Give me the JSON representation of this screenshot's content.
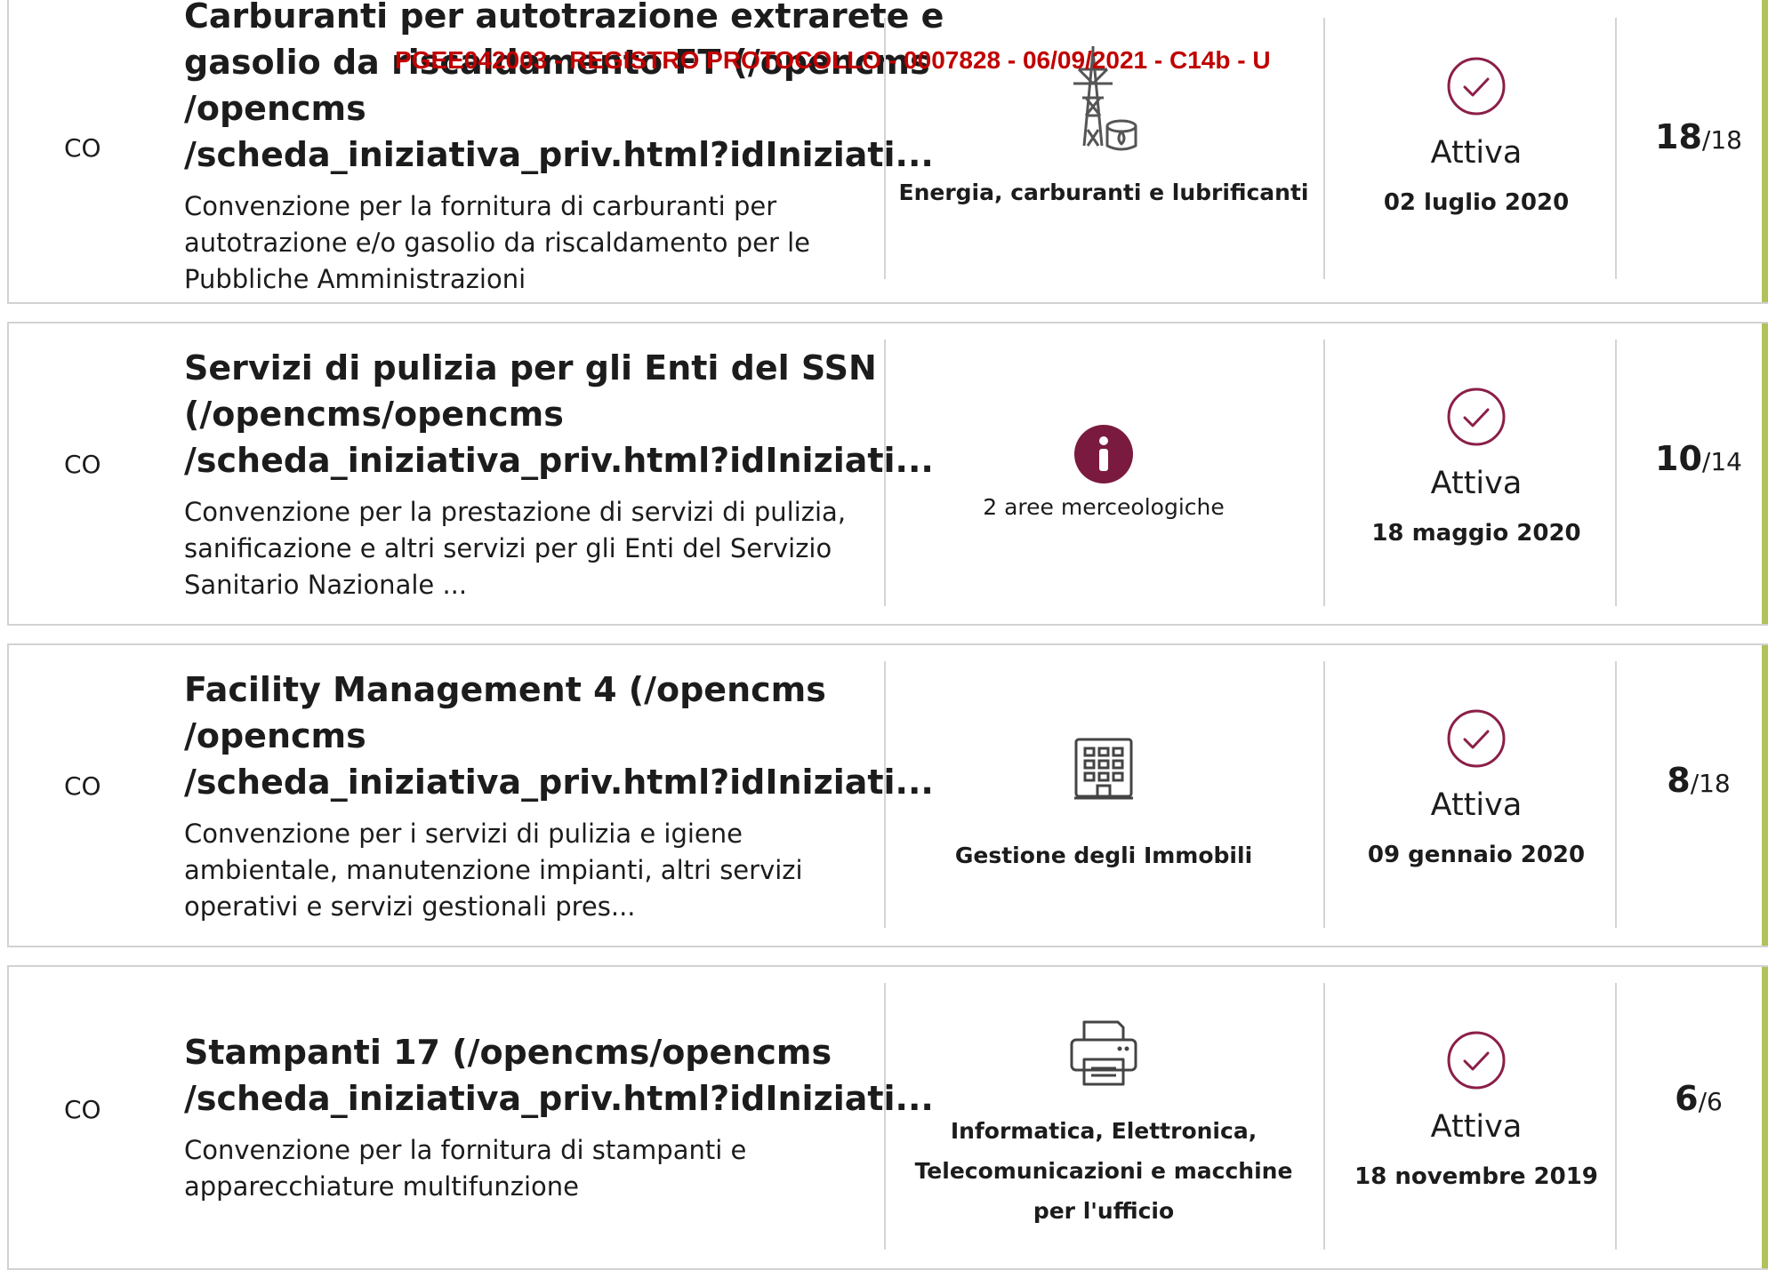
{
  "stamp_text": "PGEE042003 - REGISTRO PROTOCOLLO - 0007828 - 06/09/2021 - C14b - U",
  "colors": {
    "accent": "#b1c25b",
    "status_icon": "#8b1f49",
    "info_icon": "#7a1a3f",
    "stamp": "#c10000"
  },
  "rows": [
    {
      "type_code": "CO",
      "title_lines": [
        "Carburanti per autotrazione extrarete e",
        "gasolio da riscaldamento FT (/opencms",
        "/opencms",
        "/scheda_iniziativa_priv.html?idIniziati..."
      ],
      "desc_lines": [
        "Convenzione per la fornitura di carburanti per",
        "autotrazione e/o gasolio da riscaldamento per le",
        "Pubbliche Amministrazioni"
      ],
      "category_icon": "power-tower-fuel-icon",
      "category_label": "Energia, carburanti e lubrificanti",
      "status_icon": "check-circle-icon",
      "status": "Attiva",
      "date": "02 luglio 2020",
      "count_current": "18",
      "count_total": "/18"
    },
    {
      "type_code": "CO",
      "title_lines": [
        "Servizi di pulizia per gli Enti del SSN",
        "(/opencms/opencms",
        "/scheda_iniziativa_priv.html?idIniziati..."
      ],
      "desc_lines": [
        "Convenzione per la prestazione di servizi di pulizia,",
        "sanificazione e altri servizi per gli Enti del Servizio",
        "Sanitario Nazionale ..."
      ],
      "category_icon": "info-icon",
      "category_label": "2 aree merceologiche",
      "status_icon": "check-circle-icon",
      "status": "Attiva",
      "date": "18 maggio 2020",
      "count_current": "10",
      "count_total": "/14"
    },
    {
      "type_code": "CO",
      "title_lines": [
        "Facility Management 4 (/opencms",
        "/opencms",
        "/scheda_iniziativa_priv.html?idIniziati..."
      ],
      "desc_lines": [
        "Convenzione per i servizi di pulizia e igiene",
        "ambientale, manutenzione impianti, altri servizi",
        "operativi e servizi gestionali pres..."
      ],
      "category_icon": "building-icon",
      "category_label": "Gestione degli Immobili",
      "status_icon": "check-circle-icon",
      "status": "Attiva",
      "date": "09 gennaio 2020",
      "count_current": "8",
      "count_total": "/18"
    },
    {
      "type_code": "CO",
      "title_lines": [
        "Stampanti 17 (/opencms/opencms",
        "/scheda_iniziativa_priv.html?idIniziati..."
      ],
      "desc_lines": [
        "Convenzione per la fornitura di stampanti e",
        "apparecchiature multifunzione"
      ],
      "category_icon": "printer-icon",
      "category_label_lines": [
        "Informatica, Elettronica,",
        "Telecomunicazioni e macchine",
        "per l'ufficio"
      ],
      "status_icon": "check-circle-icon",
      "status": "Attiva",
      "date": "18 novembre 2019",
      "count_current": "6",
      "count_total": "/6"
    }
  ]
}
